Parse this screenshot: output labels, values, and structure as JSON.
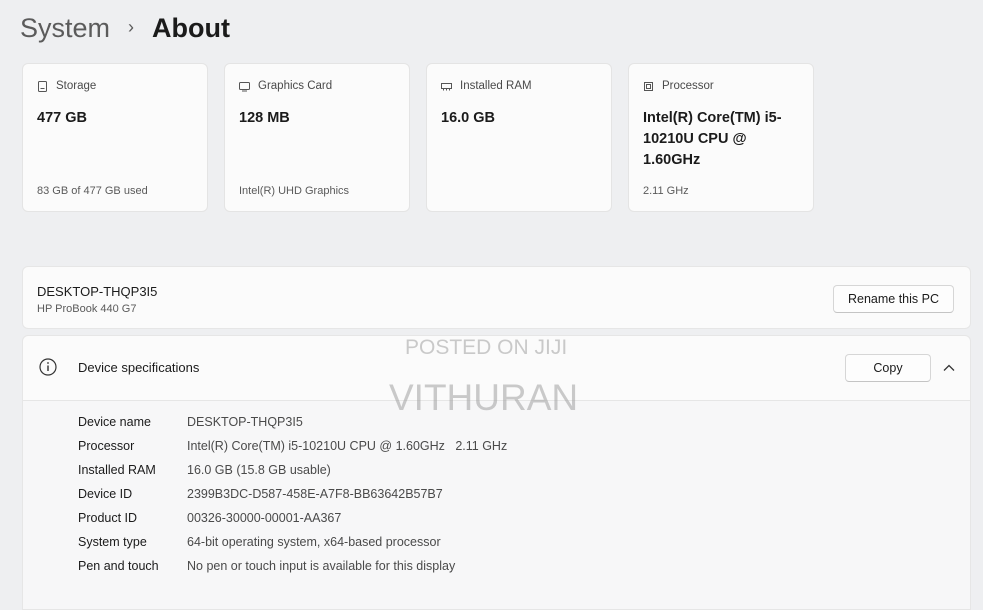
{
  "breadcrumb": {
    "parent": "System",
    "separator": "›",
    "current": "About"
  },
  "cards": [
    {
      "icon": "storage-icon",
      "label": "Storage",
      "value": "477 GB",
      "foot": "83 GB of 477 GB used"
    },
    {
      "icon": "graphics-card-icon",
      "label": "Graphics Card",
      "value": "128 MB",
      "foot": "Intel(R) UHD Graphics"
    },
    {
      "icon": "ram-icon",
      "label": "Installed RAM",
      "value": "16.0 GB",
      "foot": ""
    },
    {
      "icon": "processor-icon",
      "label": "Processor",
      "value": "Intel(R) Core(TM) i5-10210U CPU @ 1.60GHz",
      "foot": "2.11 GHz"
    }
  ],
  "device": {
    "name": "DESKTOP-THQP3I5",
    "model": "HP ProBook 440 G7",
    "rename_label": "Rename this PC"
  },
  "specs": {
    "title": "Device specifications",
    "copy_label": "Copy",
    "rows": [
      {
        "label": "Device name",
        "value": "DESKTOP-THQP3I5"
      },
      {
        "label": "Processor",
        "value": "Intel(R) Core(TM) i5-10210U CPU @ 1.60GHz   2.11 GHz"
      },
      {
        "label": "Installed RAM",
        "value": "16.0 GB (15.8 GB usable)"
      },
      {
        "label": "Device ID",
        "value": "2399B3DC-D587-458E-A7F8-BB63642B57B7"
      },
      {
        "label": "Product ID",
        "value": "00326-30000-00001-AA367"
      },
      {
        "label": "System type",
        "value": "64-bit operating system, x64-based processor"
      },
      {
        "label": "Pen and touch",
        "value": "No pen or touch input is available for this display"
      }
    ]
  },
  "watermark": {
    "line1": "POSTED ON JIJI",
    "line2": "VITHURAN"
  }
}
